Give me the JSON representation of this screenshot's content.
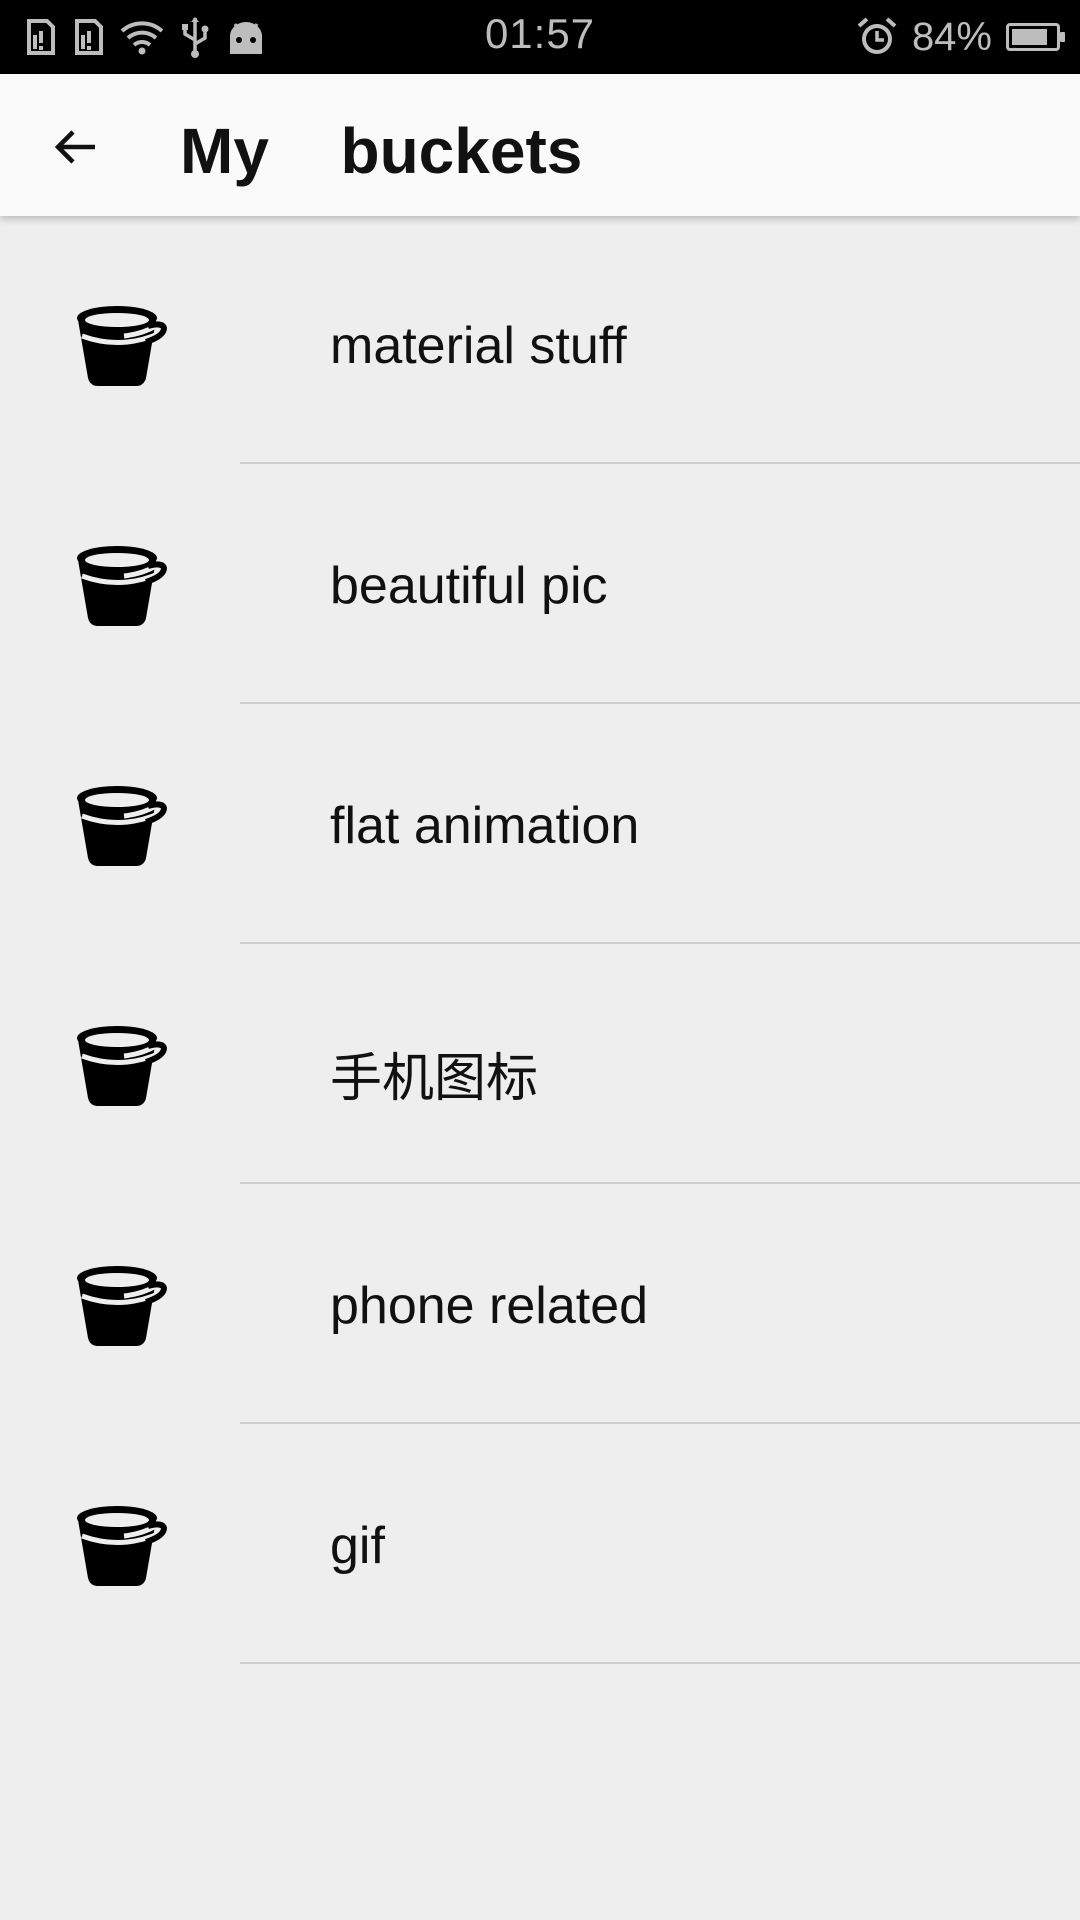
{
  "status_bar": {
    "time": "01:57",
    "battery_percent": "84%",
    "battery_level": 0.84,
    "icons_left": [
      "sim-alert-icon",
      "sim-alert-icon",
      "wifi-icon",
      "usb-icon",
      "android-icon"
    ],
    "icons_right": [
      "alarm-icon",
      "battery-icon"
    ]
  },
  "app_bar": {
    "back_icon": "arrow-back-icon",
    "title": "My  buckets"
  },
  "buckets": [
    {
      "label": "material stuff",
      "icon": "bucket-icon"
    },
    {
      "label": "beautiful pic",
      "icon": "bucket-icon"
    },
    {
      "label": "flat animation",
      "icon": "bucket-icon"
    },
    {
      "label": "手机图标",
      "icon": "bucket-icon"
    },
    {
      "label": "phone related",
      "icon": "bucket-icon"
    },
    {
      "label": "gif",
      "icon": "bucket-icon"
    }
  ]
}
